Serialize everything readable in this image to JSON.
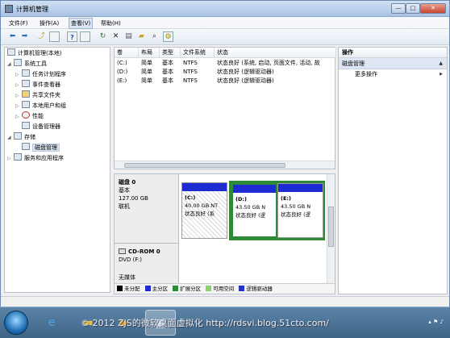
{
  "window": {
    "title": "计算机管理",
    "buttons": {
      "min": "—",
      "max": "□",
      "close": "✕"
    }
  },
  "menubar": [
    "文件(F)",
    "操作(A)",
    "查看(V)",
    "帮助(H)"
  ],
  "toolbar_icons": [
    "back-icon",
    "forward-icon",
    "up-icon",
    "show-hide-tree-icon",
    "help-icon",
    "properties-icon",
    "refresh-icon",
    "delete-icon",
    "open-icon",
    "folder-icon",
    "search-icon",
    "settings-icon"
  ],
  "tree": {
    "root": "计算机管理(本地)",
    "items": [
      {
        "label": "系统工具",
        "level": 1,
        "arrow": "◢"
      },
      {
        "label": "任务计划程序",
        "level": 2,
        "arrow": "▷"
      },
      {
        "label": "事件查看器",
        "level": 2,
        "arrow": "▷"
      },
      {
        "label": "共享文件夹",
        "level": 2,
        "arrow": "▷"
      },
      {
        "label": "本地用户和组",
        "level": 2,
        "arrow": "▷"
      },
      {
        "label": "性能",
        "level": 2,
        "arrow": "▷"
      },
      {
        "label": "设备管理器",
        "level": 2,
        "arrow": ""
      },
      {
        "label": "存储",
        "level": 1,
        "arrow": "◢"
      },
      {
        "label": "磁盘管理",
        "level": 2,
        "arrow": "",
        "selected": true
      },
      {
        "label": "服务和应用程序",
        "level": 1,
        "arrow": "▷"
      }
    ]
  },
  "volume_list": {
    "columns": [
      "卷",
      "布局",
      "类型",
      "文件系统",
      "状态"
    ],
    "rows": [
      [
        "(C:)",
        "简单",
        "基本",
        "NTFS",
        "状态良好 (系统, 启动, 页面文件, 活动, 故"
      ],
      [
        "(D:)",
        "简单",
        "基本",
        "NTFS",
        "状态良好 (逻辑驱动器)"
      ],
      [
        "(E:)",
        "简单",
        "基本",
        "NTFS",
        "状态良好 (逻辑驱动器)"
      ]
    ]
  },
  "disks": [
    {
      "name": "磁盘 0",
      "type": "基本",
      "size": "127.00 GB",
      "status": "联机",
      "volumes": [
        {
          "label": "(C:)",
          "size": "40.00 GB NT",
          "status": "状态良好 (系"
        },
        {
          "label": "(D:)",
          "size": "43.50 GB N",
          "status": "状态良好 (逻"
        },
        {
          "label": "(E:)",
          "size": "43.50 GB N",
          "status": "状态良好 (逻"
        }
      ]
    },
    {
      "name": "CD-ROM 0",
      "type": "DVD (F:)",
      "size": "",
      "status": "无媒体"
    }
  ],
  "legend": [
    {
      "label": "未分配",
      "color": "#000000"
    },
    {
      "label": "主分区",
      "color": "#1e2bd2"
    },
    {
      "label": "扩展分区",
      "color": "#2d8a36"
    },
    {
      "label": "可用空间",
      "color": "#8ad16b"
    },
    {
      "label": "逻辑驱动器",
      "color": "#2432c8"
    }
  ],
  "actions": {
    "header": "操作",
    "section": "磁盘管理",
    "link": "更多操作"
  },
  "watermark": "© 2012 ZJS的微软桌面虚拟化 http://rdsvi.blog.51cto.com/"
}
